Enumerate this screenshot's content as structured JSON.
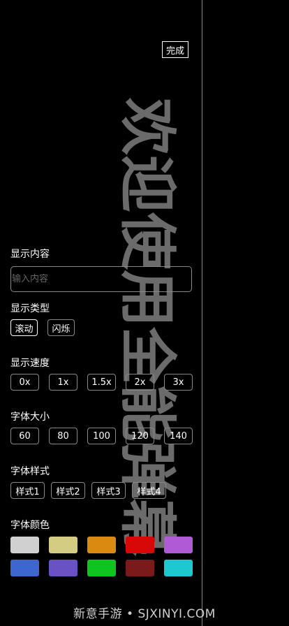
{
  "header": {
    "done_label": "完成"
  },
  "preview": {
    "text": "欢迎使用全能弹幕"
  },
  "content": {
    "label": "显示内容",
    "placeholder": "输入内容"
  },
  "display_type": {
    "label": "显示类型",
    "options": [
      "滚动",
      "闪烁"
    ],
    "selected": "滚动"
  },
  "speed": {
    "label": "显示速度",
    "options": [
      "0x",
      "1x",
      "1.5x",
      "2x",
      "3x"
    ]
  },
  "font_size": {
    "label": "字体大小",
    "options": [
      "60",
      "80",
      "100",
      "120",
      "140"
    ]
  },
  "font_style": {
    "label": "字体样式",
    "options": [
      "样式1",
      "样式2",
      "样式3",
      "样式4"
    ]
  },
  "font_color": {
    "label": "字体颜色",
    "swatches": [
      "#d0d0d0",
      "#d4cc82",
      "#d98a10",
      "#d90808",
      "#b15ad6",
      "#3d66cf",
      "#6a52c4",
      "#10c420",
      "#7a1a1a",
      "#1ec8d0"
    ]
  },
  "watermark": "新意手游 • SJXINYI.COM"
}
